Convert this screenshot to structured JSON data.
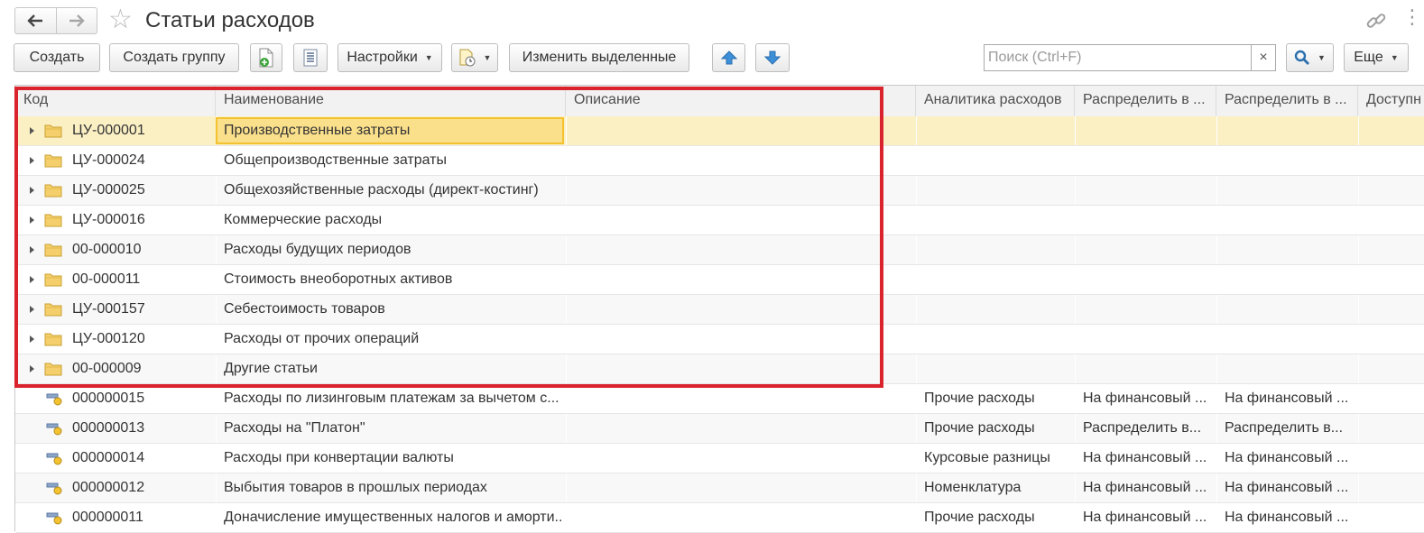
{
  "window": {
    "title": "Статьи расходов",
    "back_icon": "arrow-left-icon",
    "forward_icon": "arrow-right-icon",
    "favorite_icon": "star-icon",
    "link_icon": "link-icon",
    "menu_icon": "more-vertical-icon"
  },
  "toolbar": {
    "create": "Создать",
    "create_group": "Создать группу",
    "settings": "Настройки",
    "change_selected": "Изменить выделенные",
    "search_placeholder": "Поиск (Ctrl+F)",
    "search_clear": "×",
    "more": "Еще"
  },
  "columns": [
    "Код",
    "Наименование",
    "Описание",
    "Аналитика расходов",
    "Распределить в ...",
    "Распределить в ...",
    "Доступн"
  ],
  "rows": [
    {
      "type": "group",
      "code": "ЦУ-000001",
      "name": "Производственные затраты",
      "description": "",
      "analytics": "",
      "distribute1": "",
      "distribute2": "",
      "selected": true
    },
    {
      "type": "group",
      "code": "ЦУ-000024",
      "name": "Общепроизводственные затраты",
      "description": "",
      "analytics": "",
      "distribute1": "",
      "distribute2": ""
    },
    {
      "type": "group",
      "code": "ЦУ-000025",
      "name": "Общехозяйственные расходы (директ-костинг)",
      "description": "",
      "analytics": "",
      "distribute1": "",
      "distribute2": ""
    },
    {
      "type": "group",
      "code": "ЦУ-000016",
      "name": "Коммерческие расходы",
      "description": "",
      "analytics": "",
      "distribute1": "",
      "distribute2": ""
    },
    {
      "type": "group",
      "code": "00-000010",
      "name": "Расходы будущих периодов",
      "description": "",
      "analytics": "",
      "distribute1": "",
      "distribute2": ""
    },
    {
      "type": "group",
      "code": "00-000011",
      "name": "Стоимость внеоборотных активов",
      "description": "",
      "analytics": "",
      "distribute1": "",
      "distribute2": ""
    },
    {
      "type": "group",
      "code": "ЦУ-000157",
      "name": "Себестоимость товаров",
      "description": "",
      "analytics": "",
      "distribute1": "",
      "distribute2": ""
    },
    {
      "type": "group",
      "code": "ЦУ-000120",
      "name": "Расходы от прочих операций",
      "description": "",
      "analytics": "",
      "distribute1": "",
      "distribute2": ""
    },
    {
      "type": "group",
      "code": "00-000009",
      "name": "Другие статьи",
      "description": "",
      "analytics": "",
      "distribute1": "",
      "distribute2": ""
    },
    {
      "type": "item",
      "code": "000000015",
      "name": "Расходы по лизинговым платежам за вычетом с...",
      "description": "",
      "analytics": "Прочие расходы",
      "distribute1": "На финансовый ...",
      "distribute2": "На финансовый ..."
    },
    {
      "type": "item",
      "code": "000000013",
      "name": "Расходы на \"Платон\"",
      "description": "",
      "analytics": "Прочие расходы",
      "distribute1": "Распределить в...",
      "distribute2": "Распределить в..."
    },
    {
      "type": "item",
      "code": "000000014",
      "name": "Расходы при конвертации валюты",
      "description": "",
      "analytics": "Курсовые разницы",
      "distribute1": "На финансовый ...",
      "distribute2": "На финансовый ..."
    },
    {
      "type": "item",
      "code": "000000012",
      "name": "Выбытия товаров в прошлых периодах",
      "description": "",
      "analytics": "Номенклатура",
      "distribute1": "На финансовый ...",
      "distribute2": "На финансовый ..."
    },
    {
      "type": "item",
      "code": "000000011",
      "name": "Доначисление имущественных налогов и аморти...",
      "description": "",
      "analytics": "Прочие расходы",
      "distribute1": "На финансовый ...",
      "distribute2": "На финансовый ..."
    }
  ],
  "colors": {
    "selection_row": "#fbf0c4",
    "selection_cell": "#fbe08c",
    "annotation_frame": "#d9232d",
    "folder": "#f5cf6b"
  }
}
